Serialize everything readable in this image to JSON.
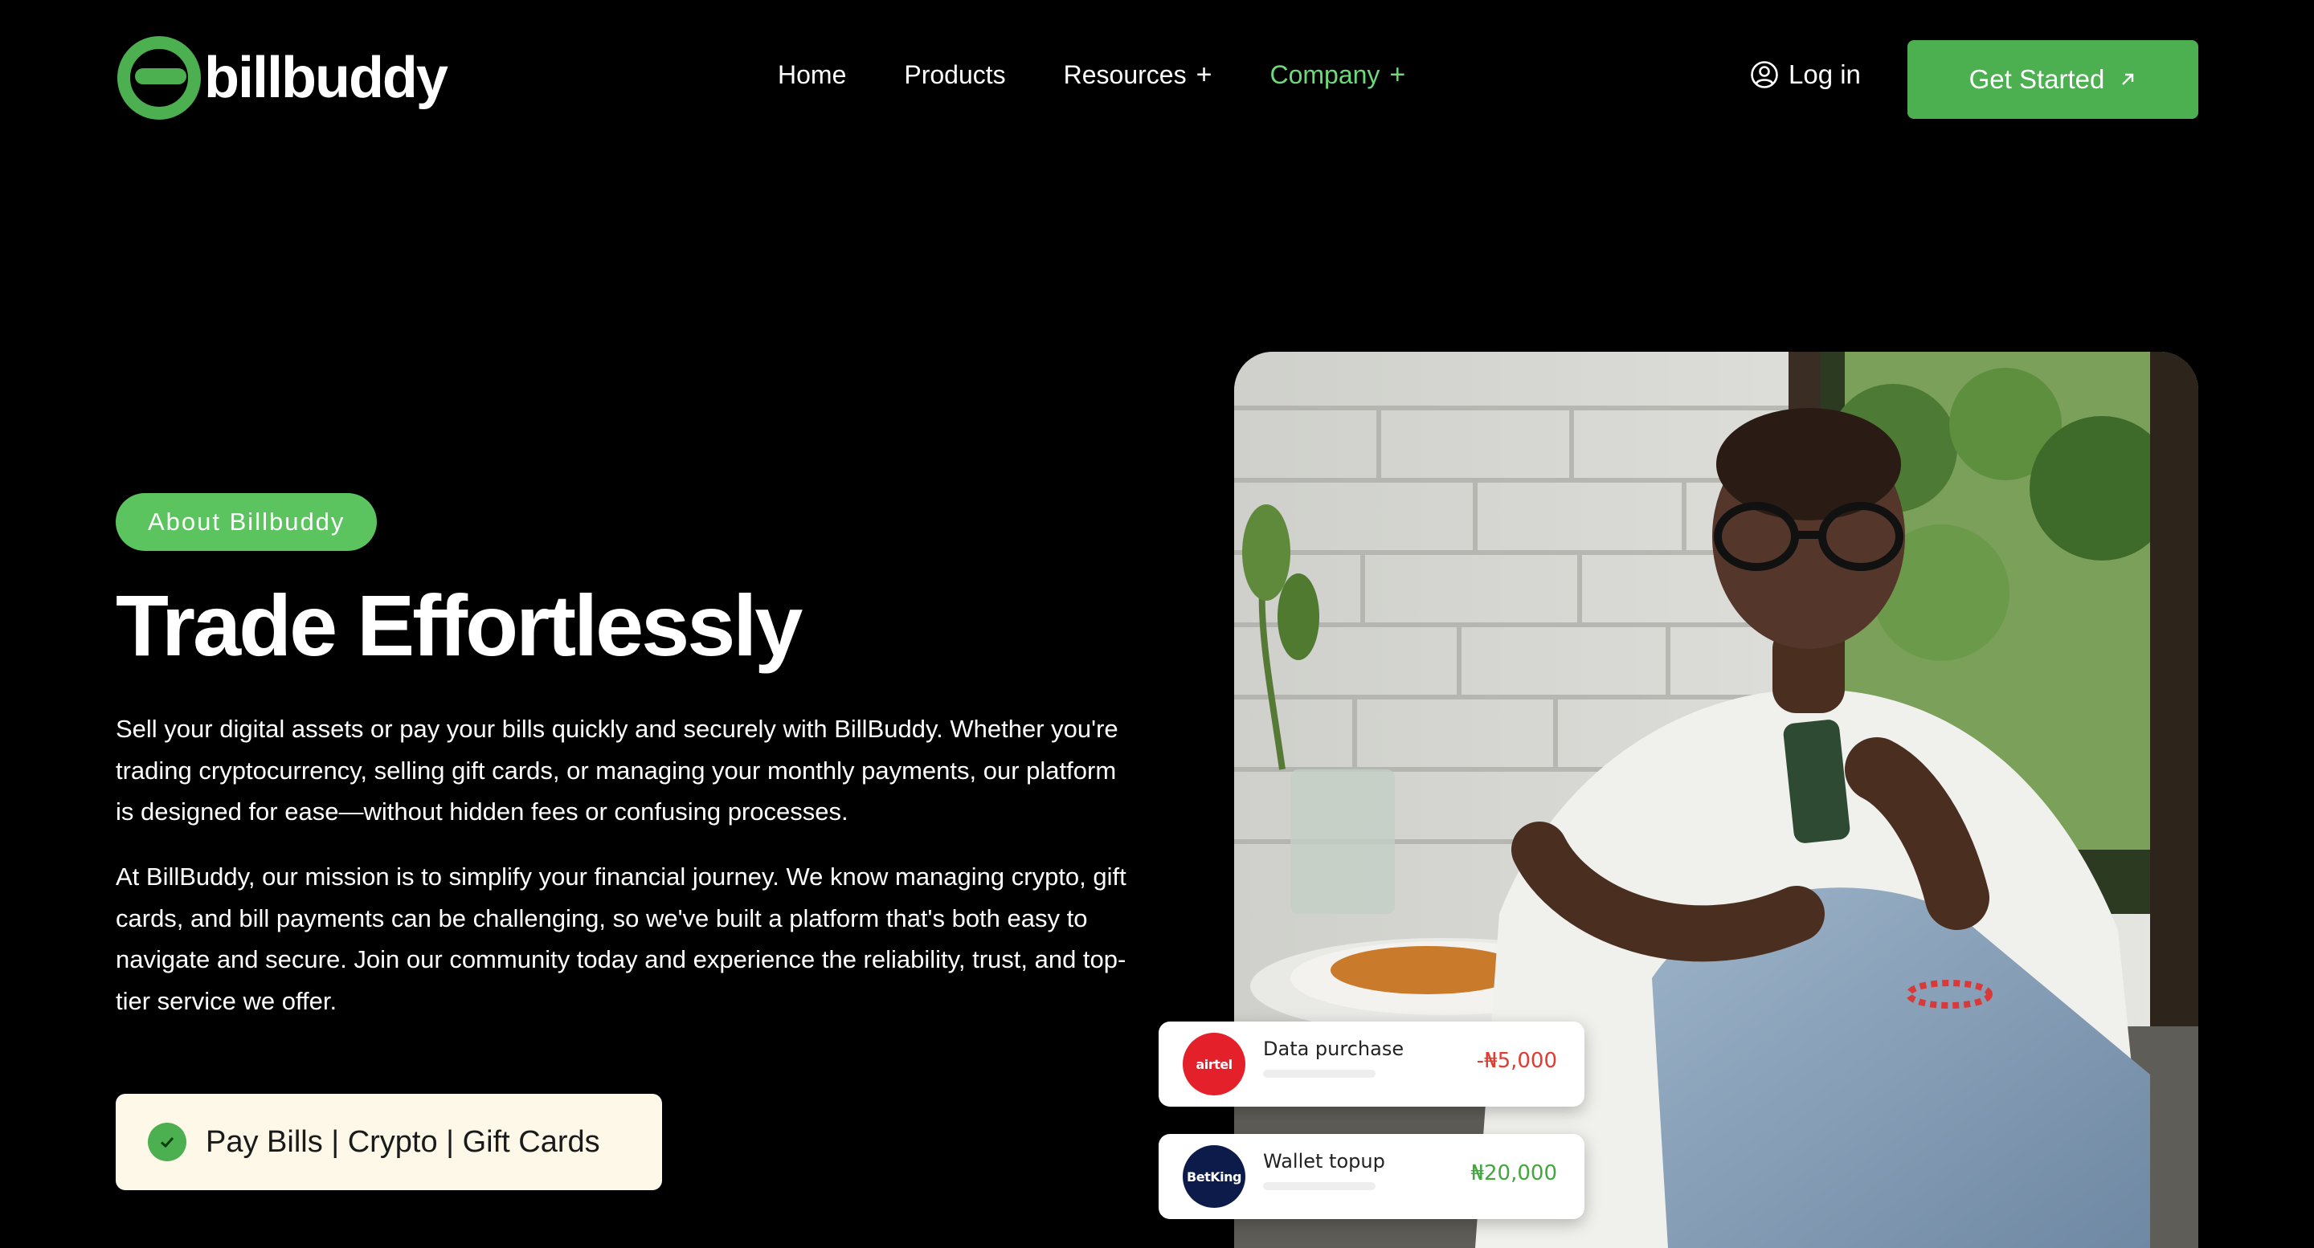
{
  "brand": {
    "name": "billbuddy",
    "accent": "#4caf50",
    "accent_light": "#6fd87a"
  },
  "nav": {
    "links": [
      {
        "label": "Home",
        "has_submenu": false,
        "active": false
      },
      {
        "label": "Products",
        "has_submenu": false,
        "active": false
      },
      {
        "label": "Resources",
        "has_submenu": true,
        "active": false
      },
      {
        "label": "Company",
        "has_submenu": true,
        "active": true
      }
    ],
    "submenu_glyph": "+",
    "login_label": "Log in",
    "login_icon": "user-circle-icon",
    "cta_label": "Get Started",
    "cta_icon": "arrow-up-right-icon"
  },
  "hero": {
    "badge": "About Billbuddy",
    "title": "Trade Effortlessly",
    "paragraph_1": "Sell your digital assets or pay your bills quickly and securely with BillBuddy. Whether you're trading cryptocurrency, selling gift cards, or managing your monthly payments, our platform is designed for ease—without hidden fees or confusing processes.",
    "paragraph_2": "At BillBuddy, our mission is to simplify your financial journey. We know managing crypto, gift cards, and bill payments can be challenging, so we've built a platform that's both easy to navigate and secure. Join our community today and experience the reliability, trust, and top-tier service we offer.",
    "feature": "Pay Bills | Crypto | Gift Cards",
    "feature_icon": "check-circle-icon"
  },
  "transactions": [
    {
      "title": "Data purchase",
      "amount": "-₦5,000",
      "logo_text": "airtel",
      "logo_color": "#e4202b",
      "amount_color": "#e23b30"
    },
    {
      "title": "Wallet topup",
      "amount": "₦20,000",
      "logo_text": "BetKing",
      "logo_color": "#0d1b4b",
      "amount_color": "#41a83c"
    }
  ]
}
